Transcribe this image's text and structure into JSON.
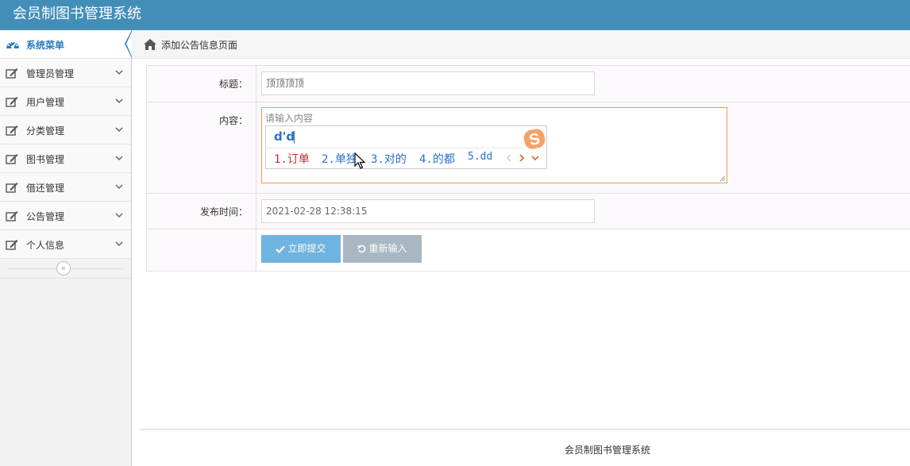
{
  "app": {
    "title": "会员制图书管理系统"
  },
  "sidebar": {
    "header": {
      "label": "系统菜单",
      "icon": "dashboard-icon"
    },
    "items": [
      {
        "label": "管理员管理",
        "icon": "edit-icon"
      },
      {
        "label": "用户管理",
        "icon": "edit-icon"
      },
      {
        "label": "分类管理",
        "icon": "edit-icon"
      },
      {
        "label": "图书管理",
        "icon": "edit-icon"
      },
      {
        "label": "借还管理",
        "icon": "edit-icon"
      },
      {
        "label": "公告管理",
        "icon": "edit-icon"
      },
      {
        "label": "个人信息",
        "icon": "edit-icon"
      }
    ],
    "collapse_glyph": "«"
  },
  "breadcrumb": {
    "icon": "home-icon",
    "text": "添加公告信息页面"
  },
  "form": {
    "title_label": "标题：",
    "title_value": "顶顶顶顶",
    "content_label": "内容：",
    "content_placeholder": "请输入内容",
    "time_label": "发布时间：",
    "time_value": "2021-02-28 12:38:15",
    "submit_label": "立即提交",
    "reset_label": "重新输入"
  },
  "ime": {
    "composition": "d'd",
    "candidates": [
      "1.订单",
      "2.单独",
      "3.对的",
      "4.的都",
      "5.dd"
    ],
    "logo_letter": "S"
  },
  "footer": {
    "text": "会员制图书管理系统"
  },
  "colors": {
    "topbar": "#438eb9",
    "accent": "#2b7dbc",
    "submit": "#6fb3e0",
    "reset": "#a8b7c1"
  }
}
